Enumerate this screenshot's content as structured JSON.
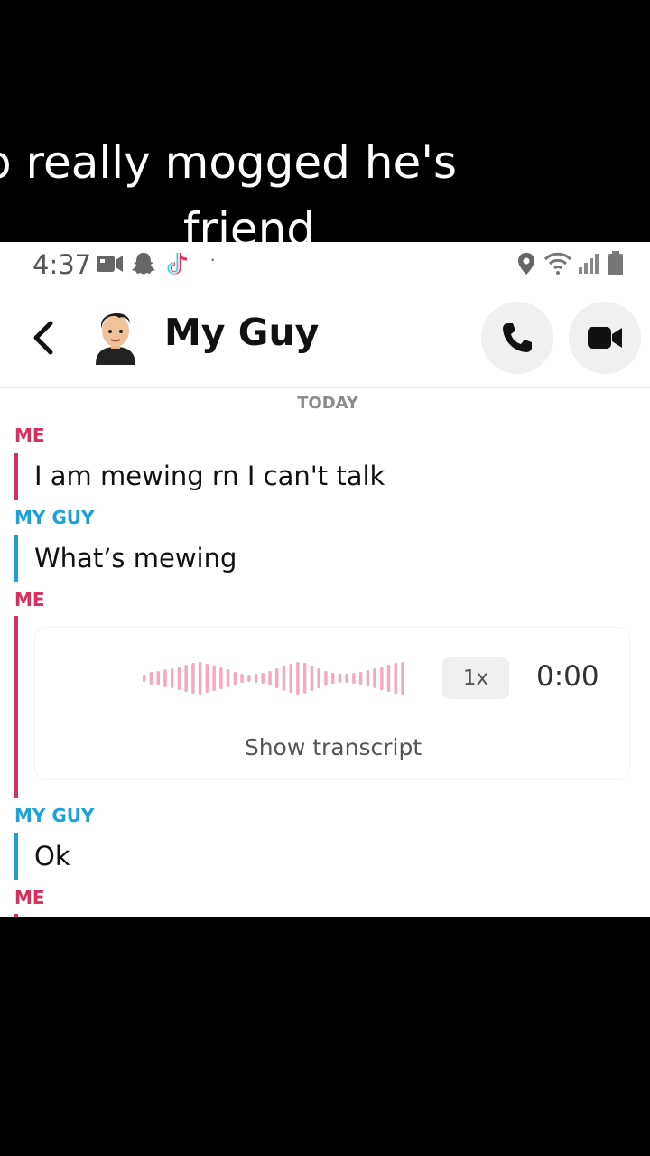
{
  "caption": {
    "line1": "o really mogged he's",
    "line2": "friend"
  },
  "status_bar": {
    "time": "4:37",
    "left_icons": [
      "video-camera-icon",
      "snapchat-ghost-icon",
      "tiktok-icon"
    ],
    "dot": "·",
    "right_icons": [
      "location-pin-icon",
      "wifi-icon",
      "signal-icon",
      "battery-icon"
    ]
  },
  "header": {
    "contact_name": "My Guy",
    "back_icon": "chevron-left-icon",
    "call_icon": "phone-icon",
    "video_icon": "video-camera-icon"
  },
  "chat": {
    "day_label": "TODAY",
    "messages": [
      {
        "sender": "ME",
        "text": "I am mewing rn I can't talk"
      },
      {
        "sender": "MY GUY",
        "text": "What’s mewing"
      },
      {
        "sender": "ME",
        "type": "voice",
        "speed": "1x",
        "duration": "0:00",
        "transcript_label": "Show transcript"
      },
      {
        "sender": "MY GUY",
        "text": "Ok"
      },
      {
        "sender": "ME",
        "text": ""
      }
    ]
  },
  "colors": {
    "me": "#d6305c",
    "guy": "#1ea0d8",
    "waveform": "#f5a9bf"
  }
}
